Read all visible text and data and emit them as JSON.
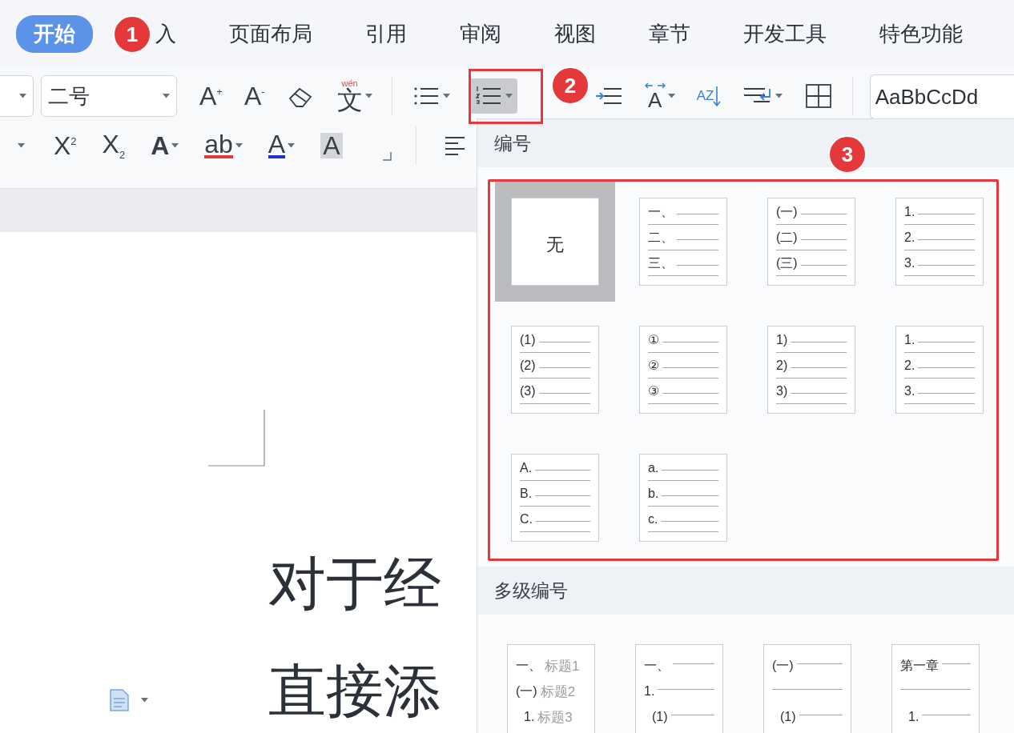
{
  "tabs": [
    {
      "label": "开始",
      "selected": true
    },
    {
      "label": "入",
      "selected": false
    },
    {
      "label": "页面布局",
      "selected": false
    },
    {
      "label": "引用",
      "selected": false
    },
    {
      "label": "审阅",
      "selected": false
    },
    {
      "label": "视图",
      "selected": false
    },
    {
      "label": "章节",
      "selected": false
    },
    {
      "label": "开发工具",
      "selected": false
    },
    {
      "label": "特色功能",
      "selected": false
    }
  ],
  "ribbon": {
    "row_1": [
      {
        "kind": "combo_stub",
        "dropdown": true
      },
      {
        "kind": "combo",
        "value": "二号",
        "dropdown": true
      },
      {
        "kind": "glyph",
        "text": "A$^{+}$"
      },
      {
        "kind": "glyph",
        "text": "A$^{-}$"
      },
      {
        "kind": "eraser"
      },
      {
        "kind": "ruby",
        "text": "文",
        "ruby": "wén",
        "dropdown": true
      },
      {
        "kind": "sep"
      },
      {
        "kind": "bullets",
        "dropdown": true
      },
      {
        "kind": "numbering",
        "dropdown": true,
        "active": true
      },
      {
        "kind": "indent"
      },
      {
        "kind": "spacing",
        "text": "A",
        "dropdown": true
      },
      {
        "kind": "sort",
        "text": "AZ"
      },
      {
        "kind": "line_spacing",
        "dropdown": true
      },
      {
        "kind": "border"
      },
      {
        "kind": "sep"
      },
      {
        "kind": "gallery",
        "text": "AaBbCcDd"
      }
    ],
    "row_2": [
      {
        "kind": "caret_stub",
        "dropdown": true
      },
      {
        "kind": "glyph",
        "text": "X$^{2}$"
      },
      {
        "kind": "glyph",
        "text": "X$_{2}$"
      },
      {
        "kind": "outline",
        "text": "A",
        "dropdown": true
      },
      {
        "kind": "underline",
        "text": "ab",
        "color": "#e0393e",
        "dropdown": true
      },
      {
        "kind": "underline",
        "text": "A",
        "color": "#1f2fd0",
        "dropdown": true
      },
      {
        "kind": "shaded",
        "text": "A"
      },
      {
        "kind": "launcher"
      },
      {
        "kind": "sep"
      },
      {
        "kind": "align"
      }
    ]
  },
  "annotations": [
    {
      "label": "1"
    },
    {
      "label": "2"
    },
    {
      "label": "3"
    }
  ],
  "numbering": {
    "title": "编号",
    "items": [
      {
        "kind": "none",
        "label": "无",
        "selected": true
      },
      {
        "kind": "list",
        "markers": [
          "一、",
          "二、",
          "三、"
        ],
        "selected": false
      },
      {
        "kind": "list",
        "markers": [
          "(一)",
          "(二)",
          "(三)"
        ],
        "selected": false
      },
      {
        "kind": "list",
        "markers": [
          "1.",
          "2.",
          "3."
        ],
        "selected": false
      },
      {
        "kind": "list",
        "markers": [
          "(1)",
          "(2)",
          "(3)"
        ],
        "selected": false
      },
      {
        "kind": "list",
        "markers": [
          "①",
          "②",
          "③"
        ],
        "selected": false
      },
      {
        "kind": "list",
        "markers": [
          "1)",
          "2)",
          "3)"
        ],
        "selected": false
      },
      {
        "kind": "list",
        "markers": [
          "1.",
          "2.",
          "3."
        ],
        "selected": false
      },
      {
        "kind": "list",
        "markers": [
          "A.",
          "B.",
          "C."
        ],
        "selected": false
      },
      {
        "kind": "list",
        "markers": [
          "a.",
          "b.",
          "c."
        ],
        "selected": false
      }
    ]
  },
  "multilevel": {
    "title": "多级编号",
    "items": [
      {
        "rows": [
          {
            "marker": "一、",
            "label": "标题1",
            "children": [
              {
                "marker": "(一)",
                "label": "标题2",
                "children": [
                  {
                    "marker": "1.",
                    "label": "标题3"
                  }
                ]
              }
            ]
          }
        ]
      },
      {
        "rows": [
          {
            "marker": "一、",
            "children": [
              {
                "marker": "1.",
                "children": [
                  {
                    "marker": "(1)"
                  }
                ]
              }
            ]
          }
        ]
      },
      {
        "rows": [
          {
            "marker": "(一)",
            "children": [
              {
                "children": [
                  {
                    "marker": "(1)"
                  }
                ]
              }
            ]
          }
        ]
      },
      {
        "rows": [
          {
            "marker": "第一章",
            "children": [
              {
                "children": [
                  {
                    "marker": "1."
                  }
                ]
              }
            ]
          }
        ]
      }
    ]
  },
  "document": {
    "lines": [
      "对于经",
      "直接添"
    ]
  }
}
